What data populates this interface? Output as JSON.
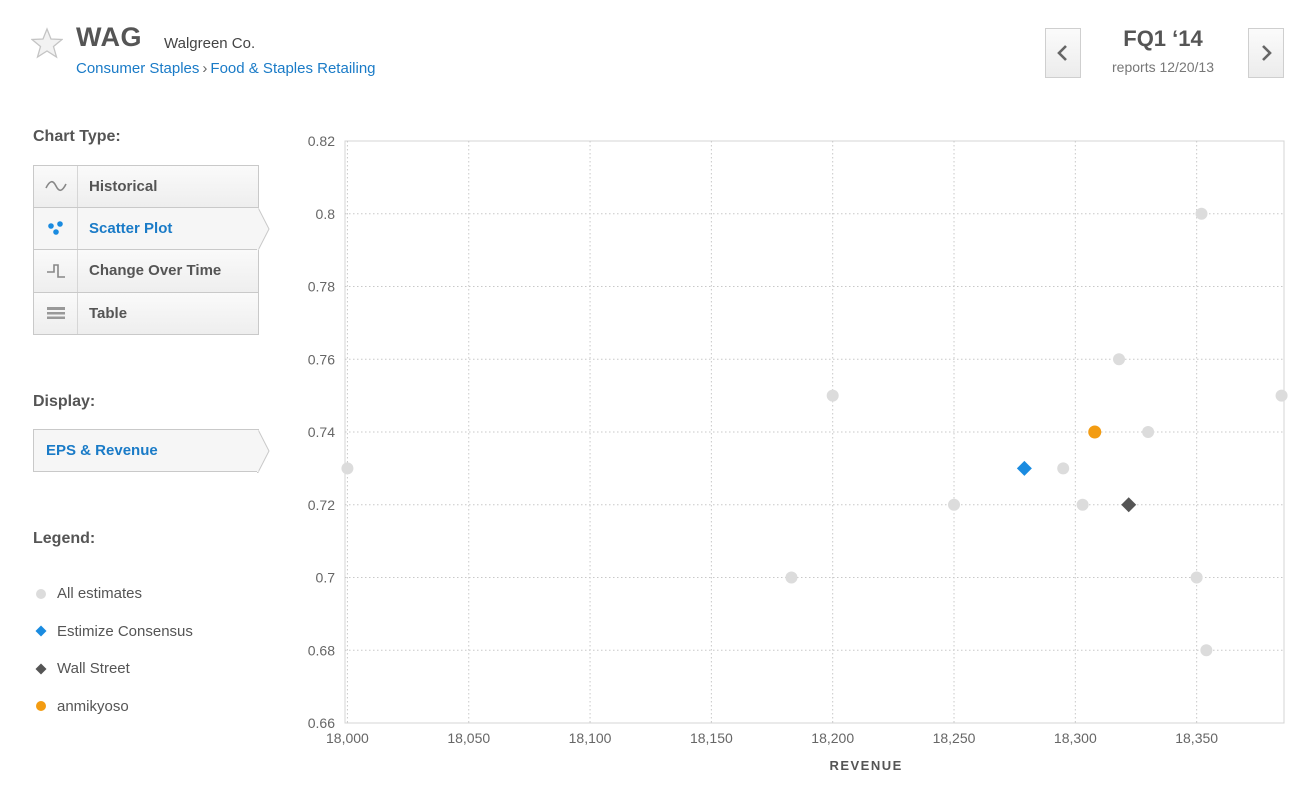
{
  "header": {
    "ticker": "WAG",
    "company": "Walgreen Co.",
    "breadcrumb": [
      "Consumer Staples",
      "Food & Staples Retailing"
    ],
    "breadcrumb_sep": "›",
    "quarter": "FQ1 ‘14",
    "reports": "reports 12/20/13"
  },
  "sidebar": {
    "chart_type_label": "Chart Type:",
    "chart_types": [
      {
        "label": "Historical",
        "icon": "wave-icon",
        "active": false
      },
      {
        "label": "Scatter Plot",
        "icon": "scatter-icon",
        "active": true
      },
      {
        "label": "Change Over Time",
        "icon": "step-icon",
        "active": false
      },
      {
        "label": "Table",
        "icon": "table-icon",
        "active": false
      }
    ],
    "display_label": "Display:",
    "display_value": "EPS & Revenue",
    "legend_label": "Legend:",
    "legend": [
      {
        "label": "All estimates",
        "marker": "circle",
        "color": "#d9d9d9"
      },
      {
        "label": "Estimize Consensus",
        "marker": "diamond",
        "color": "#1a8be0"
      },
      {
        "label": "Wall Street",
        "marker": "diamond",
        "color": "#555555"
      },
      {
        "label": "anmikyoso",
        "marker": "circle",
        "color": "#f39c12"
      }
    ]
  },
  "chart_data": {
    "type": "scatter",
    "xlabel": "REVENUE",
    "ylabel": "",
    "xlim": [
      17999,
      18386
    ],
    "ylim": [
      0.66,
      0.82
    ],
    "xticks": [
      18000,
      18050,
      18100,
      18150,
      18200,
      18250,
      18300,
      18350
    ],
    "xtick_labels": [
      "18,000",
      "18,050",
      "18,100",
      "18,150",
      "18,200",
      "18,250",
      "18,300",
      "18,350"
    ],
    "yticks": [
      0.66,
      0.68,
      0.7,
      0.72,
      0.74,
      0.76,
      0.78,
      0.8,
      0.82
    ],
    "ytick_labels": [
      "0.66",
      "0.68",
      "0.7",
      "0.72",
      "0.74",
      "0.76",
      "0.78",
      "0.8",
      "0.82"
    ],
    "grid": true,
    "series": [
      {
        "name": "All estimates",
        "marker": "circle",
        "color": "#dcdcdc",
        "points": [
          [
            18000,
            0.73
          ],
          [
            18183,
            0.7
          ],
          [
            18200,
            0.75
          ],
          [
            18250,
            0.72
          ],
          [
            18295,
            0.73
          ],
          [
            18303,
            0.72
          ],
          [
            18318,
            0.76
          ],
          [
            18330,
            0.74
          ],
          [
            18350,
            0.7
          ],
          [
            18352,
            0.8
          ],
          [
            18354,
            0.68
          ],
          [
            18385,
            0.75
          ]
        ]
      },
      {
        "name": "Estimize Consensus",
        "marker": "diamond",
        "color": "#1a8be0",
        "points": [
          [
            18279,
            0.73
          ]
        ]
      },
      {
        "name": "Wall Street",
        "marker": "diamond",
        "color": "#555555",
        "points": [
          [
            18322,
            0.72
          ]
        ]
      },
      {
        "name": "anmikyoso",
        "marker": "circle",
        "color": "#f39c12",
        "points": [
          [
            18308,
            0.74
          ]
        ]
      }
    ]
  }
}
